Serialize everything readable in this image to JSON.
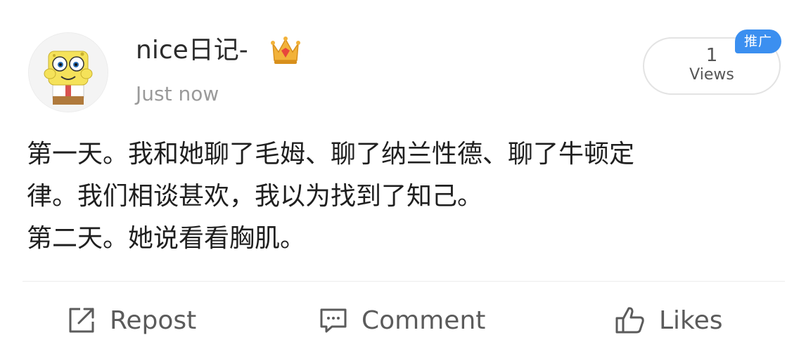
{
  "post": {
    "username": "nice日记-",
    "timestamp": "Just now",
    "views_count": "1",
    "views_label": "Views",
    "promo_badge": "推广",
    "body_lines": [
      "第一天。我和她聊了毛姆、聊了纳兰性德、聊了牛顿定",
      "律。我们相谈甚欢，我以为找到了知己。",
      "第二天。她说看看胸肌。"
    ]
  },
  "actions": {
    "repost": "Repost",
    "comment": "Comment",
    "like": "Likes"
  },
  "colors": {
    "badge": "#3b8ff0",
    "crown": "#f2b23a",
    "crown_gem": "#e8453c",
    "avatar_face": "#f5e25a"
  },
  "icons": [
    "sponge-avatar",
    "crown-icon",
    "repost-icon",
    "comment-icon",
    "like-icon"
  ]
}
